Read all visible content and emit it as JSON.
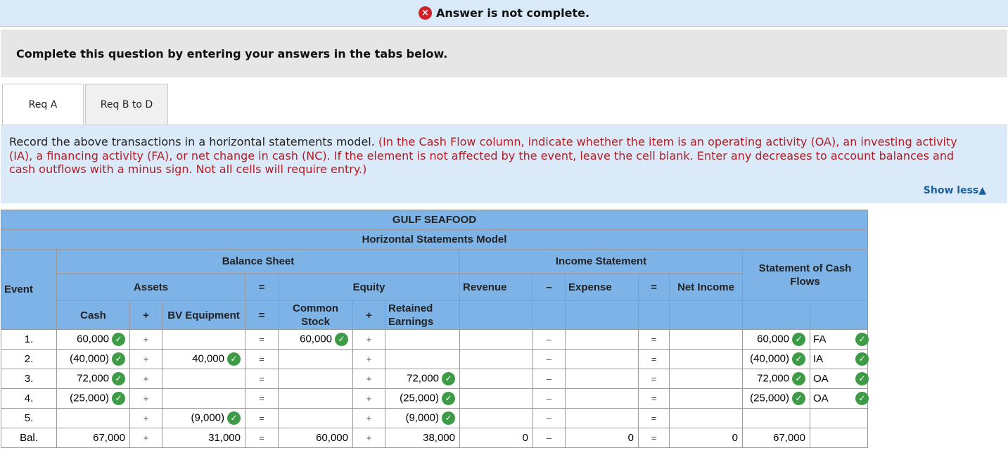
{
  "banner": {
    "icon": "×",
    "text": "Answer is not complete."
  },
  "instruction": "Complete this question by entering your answers in the tabs below.",
  "tabs": [
    {
      "label": "Req A"
    },
    {
      "label": "Req B to D"
    }
  ],
  "requirement": {
    "lead": "Record the above transactions in a horizontal statements model.",
    "note": "(In the Cash Flow column, indicate whether the item is an operating activity (OA), an investing activity (IA), a financing activity (FA), or net change in cash (NC). If the element is not affected by the event, leave the cell blank. Enter any decreases to account balances and cash outflows with a minus sign. Not all cells will require entry.)",
    "show_less": "Show less▲"
  },
  "table": {
    "company": "GULF SEAFOOD",
    "title": "Horizontal Statements Model",
    "event_header": "Event",
    "balance_sheet": "Balance Sheet",
    "income_statement": "Income Statement",
    "cash_flows_header": "Statement of Cash Flows",
    "assets": "Assets",
    "equity": "Equity",
    "revenue": "Revenue",
    "expense": "Expense",
    "net_income": "Net Income",
    "cash": "Cash",
    "bv_equipment": "BV Equipment",
    "common_stock": "Common Stock",
    "retained_earnings": "Retained Earnings",
    "plus": "+",
    "equals": "=",
    "minus": "–",
    "rows": [
      {
        "event": "1.",
        "cash": "60,000",
        "bv": "",
        "cs": "60,000",
        "re": "",
        "rev": "",
        "exp": "",
        "ni": "",
        "scf": "60,000",
        "act": "FA",
        "ok_cash": true,
        "ok_bv": false,
        "ok_cs": true,
        "ok_re": false,
        "ok_scf": true,
        "ok_row": true
      },
      {
        "event": "2.",
        "cash": "(40,000)",
        "bv": "40,000",
        "cs": "",
        "re": "",
        "rev": "",
        "exp": "",
        "ni": "",
        "scf": "(40,000)",
        "act": "IA",
        "ok_cash": true,
        "ok_bv": true,
        "ok_cs": false,
        "ok_re": false,
        "ok_scf": true,
        "ok_row": true
      },
      {
        "event": "3.",
        "cash": "72,000",
        "bv": "",
        "cs": "",
        "re": "72,000",
        "rev": "",
        "exp": "",
        "ni": "",
        "scf": "72,000",
        "act": "OA",
        "ok_cash": true,
        "ok_bv": false,
        "ok_cs": false,
        "ok_re": true,
        "ok_scf": true,
        "ok_row": true
      },
      {
        "event": "4.",
        "cash": "(25,000)",
        "bv": "",
        "cs": "",
        "re": "(25,000)",
        "rev": "",
        "exp": "",
        "ni": "",
        "scf": "(25,000)",
        "act": "OA",
        "ok_cash": true,
        "ok_bv": false,
        "ok_cs": false,
        "ok_re": true,
        "ok_scf": true,
        "ok_row": true
      },
      {
        "event": "5.",
        "cash": "",
        "bv": "(9,000)",
        "cs": "",
        "re": "(9,000)",
        "rev": "",
        "exp": "",
        "ni": "",
        "scf": "",
        "act": "",
        "ok_cash": false,
        "ok_bv": true,
        "ok_cs": false,
        "ok_re": true,
        "ok_scf": false,
        "ok_row": false
      },
      {
        "event": "Bal.",
        "cash": "67,000",
        "bv": "31,000",
        "cs": "60,000",
        "re": "38,000",
        "rev": "0",
        "exp": "0",
        "ni": "0",
        "scf": "67,000",
        "act": "",
        "ok_cash": false,
        "ok_bv": false,
        "ok_cs": false,
        "ok_re": false,
        "ok_scf": false,
        "ok_row": false
      }
    ]
  },
  "colors": {
    "header_blue": "#7eb3e8",
    "check_green": "#3d9b45",
    "error_red": "#d31f26",
    "note_red": "#b21c24"
  }
}
